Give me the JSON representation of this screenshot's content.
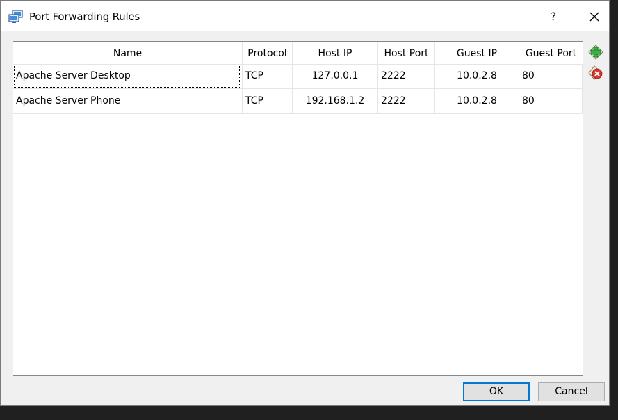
{
  "window": {
    "title": "Port Forwarding Rules",
    "help_label": "?",
    "icon": "network-adapter-icon"
  },
  "table": {
    "columns": [
      "Name",
      "Protocol",
      "Host IP",
      "Host Port",
      "Guest IP",
      "Guest Port"
    ],
    "rows": [
      {
        "name": "Apache Server Desktop",
        "protocol": "TCP",
        "host_ip": "127.0.0.1",
        "host_port": "2222",
        "guest_ip": "10.0.2.8",
        "guest_port": "80"
      },
      {
        "name": "Apache Server Phone",
        "protocol": "TCP",
        "host_ip": "192.168.1.2",
        "host_port": "2222",
        "guest_ip": "10.0.2.8",
        "guest_port": "80"
      }
    ],
    "focused_row": 0
  },
  "side_buttons": {
    "add_icon": "add-rule-icon",
    "remove_icon": "remove-rule-icon"
  },
  "buttons": {
    "ok": "OK",
    "cancel": "Cancel"
  },
  "colors": {
    "accent": "#0078d7",
    "add_green": "#3cb043",
    "remove_red": "#d9372c"
  }
}
